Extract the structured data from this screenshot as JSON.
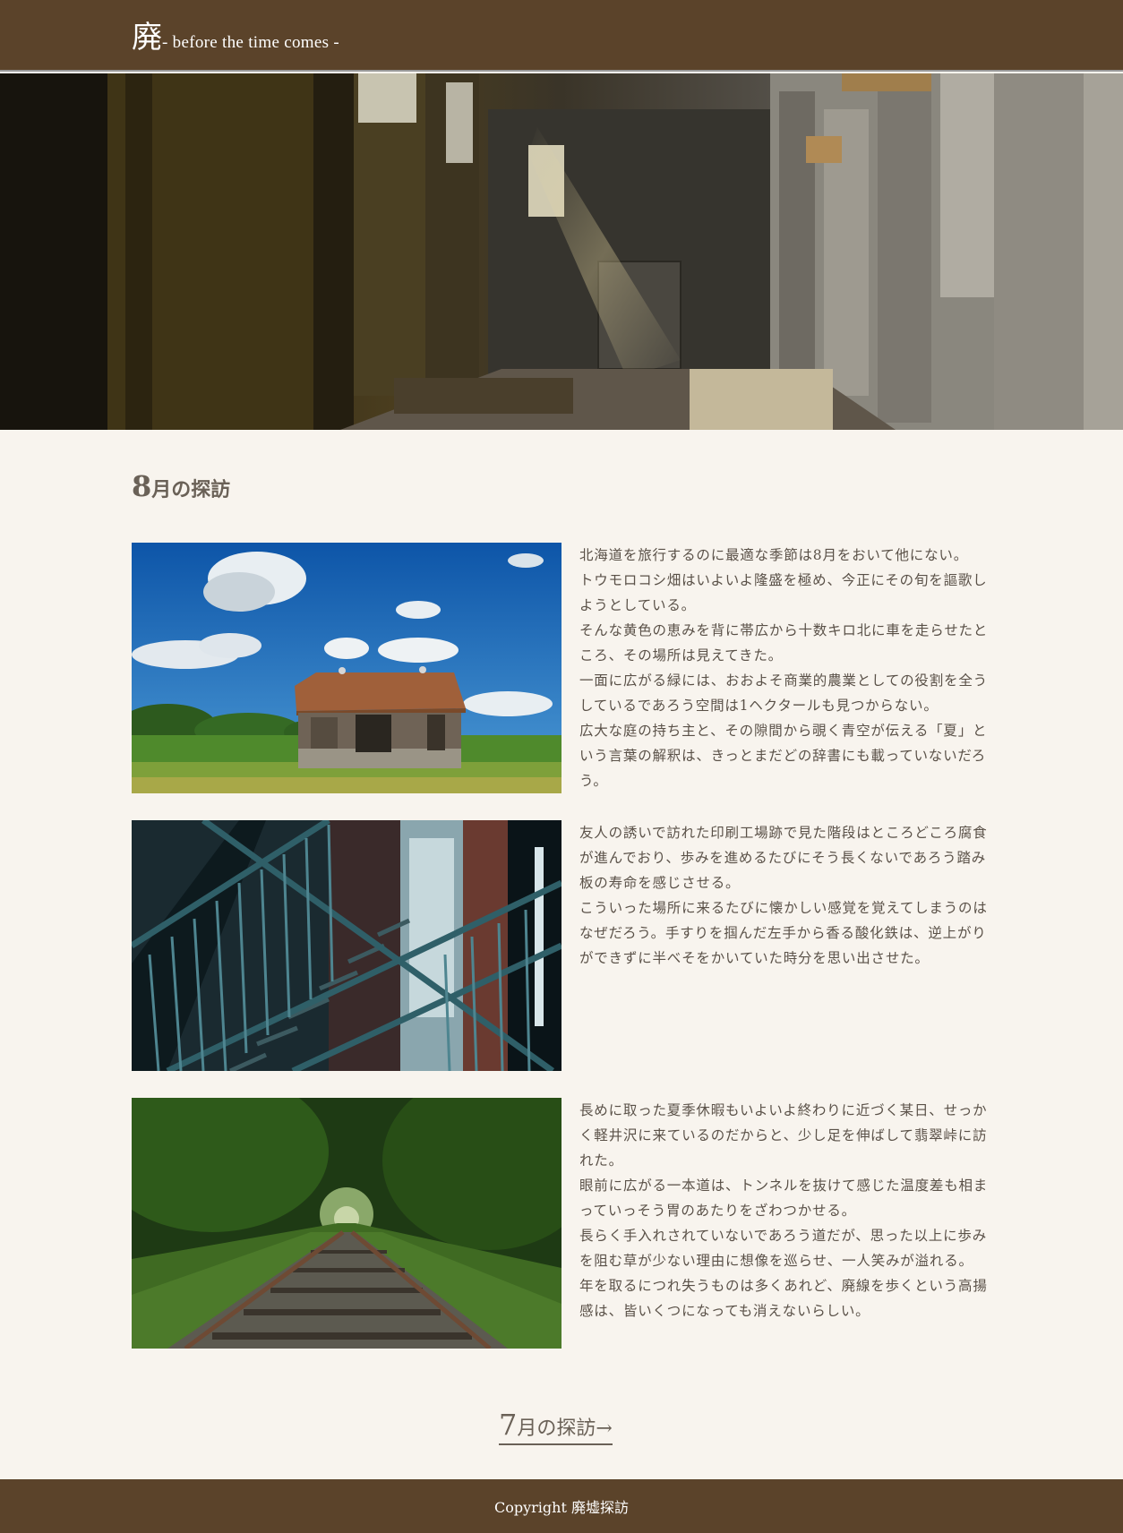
{
  "header": {
    "logo_kanji": "廃",
    "tagline": "- before the time comes -",
    "background_color": "#5b432a"
  },
  "hero": {
    "image": "abandoned-factory-interior-photo"
  },
  "section": {
    "title_number": "8",
    "title_rest": "月の探訪"
  },
  "entries": [
    {
      "image": "abandoned-barn-photo",
      "paragraphs": [
        "北海道を旅行するのに最適な季節は8月をおいて他にない。",
        "トウモロコシ畑はいよいよ隆盛を極め、今正にその旬を謳歌しようとしている。",
        "そんな黄色の恵みを背に帯広から十数キロ北に車を走らせたところ、その場所は見えてきた。",
        "一面に広がる緑には、おおよそ商業的農業としての役割を全うしているであろう空間は1ヘクタールも見つからない。",
        "広大な庭の持ち主と、その隙間から覗く青空が伝える「夏」という言葉の解釈は、きっとまだどの辞書にも載っていないだろう。"
      ]
    },
    {
      "image": "rusty-staircase-photo",
      "paragraphs": [
        "友人の誘いで訪れた印刷工場跡で見た階段はところどころ腐食が進んでおり、歩みを進めるたびにそう長くないであろう踏み板の寿命を感じさせる。",
        "こういった場所に来るたびに懐かしい感覚を覚えてしまうのはなぜだろう。手すりを掴んだ左手から香る酸化鉄は、逆上がりができずに半べそをかいていた時分を思い出させた。"
      ]
    },
    {
      "image": "abandoned-railway-photo",
      "paragraphs": [
        "長めに取った夏季休暇もいよいよ終わりに近づく某日、せっかく軽井沢に来ているのだからと、少し足を伸ばして翡翠峠に訪れた。",
        "眼前に広がる一本道は、トンネルを抜けて感じた温度差も相まっていっそう胃のあたりをざわつかせる。",
        "長らく手入れされていないであろう道だが、思った以上に歩みを阻む草が少ない理由に想像を巡らせ、一人笑みが溢れる。 年を取るにつれ失うものは多くあれど、廃線を歩くという高揚感は、皆いくつになっても消えないらしい。"
      ]
    }
  ],
  "next_link": {
    "number": "7",
    "rest": "月の探訪→"
  },
  "footer": {
    "copyright": "Copyright 廃墟探訪"
  }
}
